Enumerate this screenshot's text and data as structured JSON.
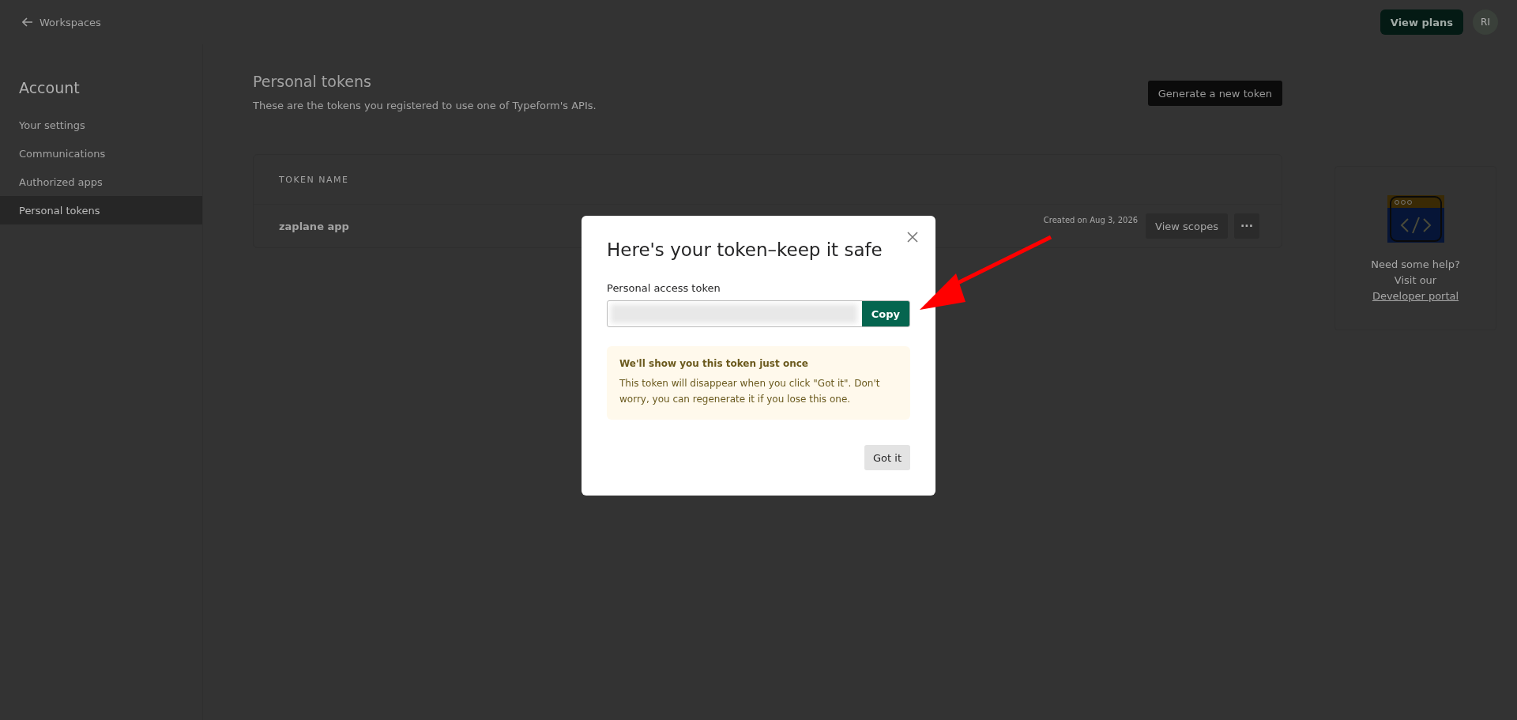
{
  "header": {
    "back_link": "Workspaces",
    "plans_button": "View plans",
    "avatar": "RI"
  },
  "sidebar": {
    "title": "Account",
    "items": [
      {
        "label": "Your settings",
        "selected": false
      },
      {
        "label": "Communications",
        "selected": false
      },
      {
        "label": "Authorized apps",
        "selected": false
      },
      {
        "label": "Personal tokens",
        "selected": true
      }
    ]
  },
  "main": {
    "title": "Personal tokens",
    "subtitle": "These are the tokens you registered to use one of Typeform's APIs.",
    "generate_button": "Generate a new token",
    "table": {
      "columns": [
        "TOKEN NAME"
      ],
      "rows": [
        {
          "name": "zaplane app",
          "created": "Created on Aug 3, 2026",
          "scopes_button": "View scopes",
          "more_button": "···"
        }
      ]
    }
  },
  "help": {
    "line_1": "Need some help?",
    "line_2": "Visit our",
    "link": "Developer portal"
  },
  "dialog": {
    "title": "Here's your token–keep it safe",
    "field_label": "Personal access token",
    "copy_button": "Copy",
    "notice_title": "We'll show you this token just once",
    "notice_text": "This token will disappear when you click \"Got it\". Don't worry, you can regenerate it if you lose this one.",
    "confirm_button": "Got it"
  }
}
